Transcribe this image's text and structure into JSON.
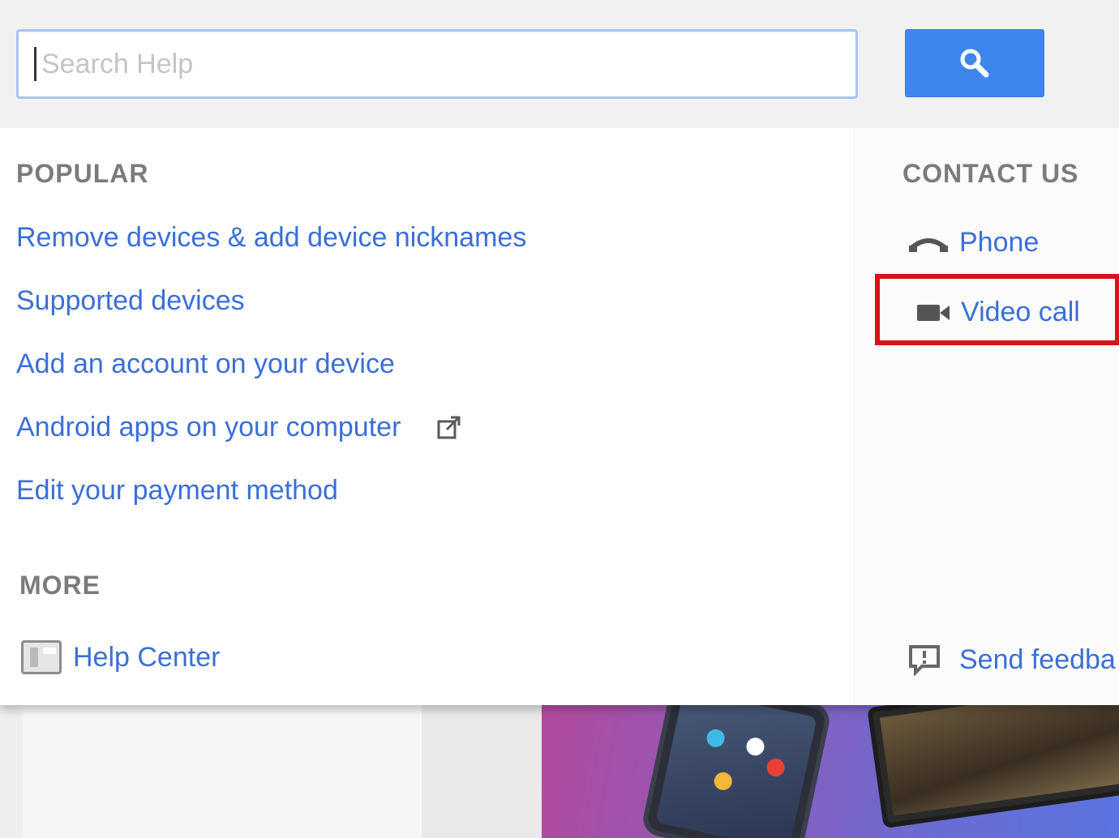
{
  "search": {
    "placeholder": "Search Help",
    "value": ""
  },
  "popular": {
    "title": "POPULAR",
    "links": [
      "Remove devices & add device nicknames",
      "Supported devices",
      "Add an account on your device",
      "Android apps on your computer",
      "Edit your payment method"
    ]
  },
  "more": {
    "title": "MORE",
    "help_center": "Help Center"
  },
  "contact": {
    "title": "CONTACT US",
    "phone": "Phone",
    "video_call": "Video call",
    "send_feedback": "Send feedba"
  },
  "colors": {
    "link": "#3b6fd6",
    "search_button": "#3f86ec",
    "highlight": "#d9111a",
    "section_title": "#7b7b7b"
  },
  "icons": {
    "search_button": "search-icon",
    "external_link": "external-link-icon",
    "help_center": "help-center-icon",
    "phone": "phone-icon",
    "video_call": "video-camera-icon",
    "feedback": "feedback-icon"
  }
}
